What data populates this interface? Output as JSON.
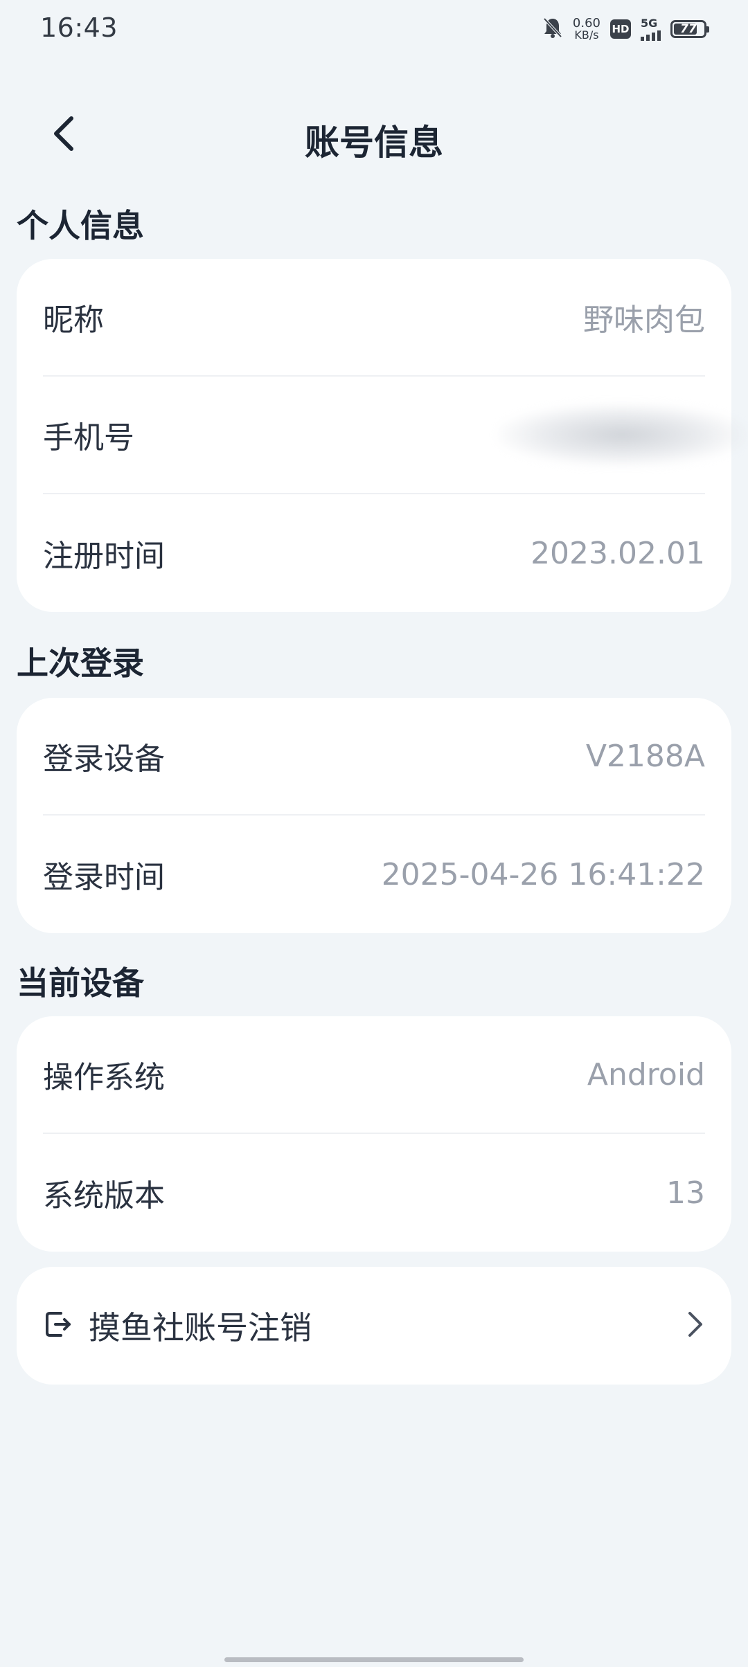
{
  "status_bar": {
    "time": "16:43",
    "net_speed": "0.60",
    "net_unit": "KB/s",
    "hd": "HD",
    "network": "5G",
    "battery": 77,
    "icons": [
      "mute-bell-icon",
      "hd-icon",
      "signal-icon",
      "battery-icon"
    ]
  },
  "header": {
    "title": "账号信息",
    "back_icon": "chevron-left-icon"
  },
  "sections": {
    "personal": {
      "title": "个人信息",
      "rows": [
        {
          "label": "昵称",
          "value": "野味肉包"
        },
        {
          "label": "手机号",
          "value": ""
        },
        {
          "label": "注册时间",
          "value": "2023.02.01"
        }
      ]
    },
    "last_login": {
      "title": "上次登录",
      "rows": [
        {
          "label": "登录设备",
          "value": "V2188A"
        },
        {
          "label": "登录时间",
          "value": "2025-04-26 16:41:22"
        }
      ]
    },
    "current_device": {
      "title": "当前设备",
      "rows": [
        {
          "label": "操作系统",
          "value": "Android"
        },
        {
          "label": "系统版本",
          "value": "13"
        }
      ]
    }
  },
  "deactivate": {
    "label": "摸鱼社账号注销",
    "icon": "logout-icon",
    "arrow_icon": "chevron-right-icon"
  }
}
